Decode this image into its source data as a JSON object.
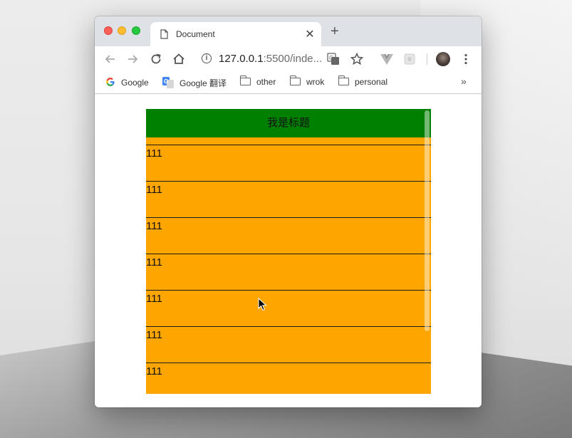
{
  "browser": {
    "tab": {
      "title": "Document",
      "close_icon": "close-icon",
      "page_icon": "document-icon"
    },
    "new_tab_icon": "plus-icon",
    "toolbar": {
      "url_host": "127.0.0.1",
      "url_rest": ":5500/inde...",
      "icons": [
        "back-arrow-icon",
        "forward-arrow-icon",
        "reload-icon",
        "home-icon",
        "info-icon",
        "translate-icon",
        "star-icon",
        "vue-devtools-icon",
        "extension-icon",
        "profile-avatar",
        "more-vertical-icon"
      ]
    },
    "bookmarks": [
      {
        "label": "Google",
        "icon": "google-icon"
      },
      {
        "label": "Google 翻译",
        "icon": "google-translate-icon"
      },
      {
        "label": "other",
        "icon": "folder-icon"
      },
      {
        "label": "wrok",
        "icon": "folder-icon"
      },
      {
        "label": "personal",
        "icon": "folder-icon"
      }
    ],
    "bookmarks_overflow": "»"
  },
  "page": {
    "header_title": "我是标题",
    "items": [
      "111",
      "111",
      "111",
      "111",
      "111",
      "111",
      "111"
    ],
    "colors": {
      "header": "#008000",
      "body": "#ffa500",
      "divider": "#1a1a1a"
    }
  }
}
